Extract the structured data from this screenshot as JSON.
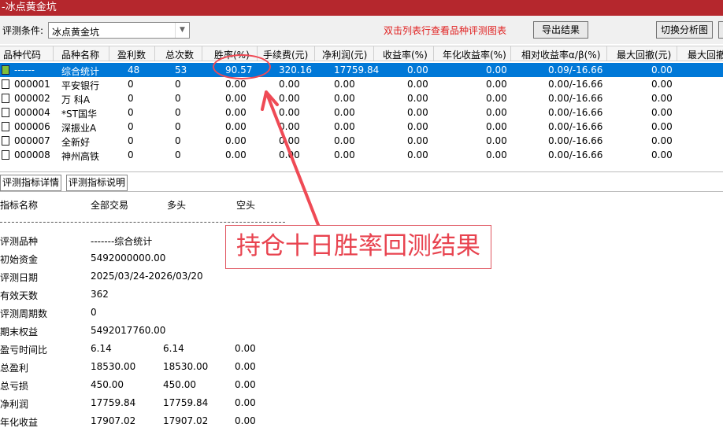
{
  "window": {
    "title": "-冰点黄金坑"
  },
  "toolbar": {
    "condition_label": "评测条件:",
    "condition_value": "冰点黄金坑",
    "hint": "双击列表行查看品种评测图表",
    "export_label": "导出结果",
    "switch_label": "切换分析图"
  },
  "table": {
    "headers": [
      "品种代码",
      "品种名称",
      "盈利数",
      "总次数",
      "胜率(%)",
      "手续费(元)",
      "净利润(元)",
      "收益率(%)",
      "年化收益率(%)",
      "相对收益率α/β(%)",
      "最大回撤(元)",
      "最大回撤"
    ],
    "rows": [
      {
        "code": "------",
        "name": "综合统计",
        "profit_count": "48",
        "total": "53",
        "win_rate": "90.57",
        "fee": "320.16",
        "net": "17759.84",
        "ret": "0.00",
        "annual": "0.00",
        "alpha": "0.09/-16.66",
        "drawdown": "0.00"
      },
      {
        "code": "000001",
        "name": "平安银行",
        "profit_count": "0",
        "total": "0",
        "win_rate": "0.00",
        "fee": "0.00",
        "net": "0.00",
        "ret": "0.00",
        "annual": "0.00",
        "alpha": "0.00/-16.66",
        "drawdown": "0.00"
      },
      {
        "code": "000002",
        "name": "万 科A",
        "profit_count": "0",
        "total": "0",
        "win_rate": "0.00",
        "fee": "0.00",
        "net": "0.00",
        "ret": "0.00",
        "annual": "0.00",
        "alpha": "0.00/-16.66",
        "drawdown": "0.00"
      },
      {
        "code": "000004",
        "name": "*ST国华",
        "profit_count": "0",
        "total": "0",
        "win_rate": "0.00",
        "fee": "0.00",
        "net": "0.00",
        "ret": "0.00",
        "annual": "0.00",
        "alpha": "0.00/-16.66",
        "drawdown": "0.00"
      },
      {
        "code": "000006",
        "name": "深振业A",
        "profit_count": "0",
        "total": "0",
        "win_rate": "0.00",
        "fee": "0.00",
        "net": "0.00",
        "ret": "0.00",
        "annual": "0.00",
        "alpha": "0.00/-16.66",
        "drawdown": "0.00"
      },
      {
        "code": "000007",
        "name": "全新好",
        "profit_count": "0",
        "total": "0",
        "win_rate": "0.00",
        "fee": "0.00",
        "net": "0.00",
        "ret": "0.00",
        "annual": "0.00",
        "alpha": "0.00/-16.66",
        "drawdown": "0.00"
      },
      {
        "code": "000008",
        "name": "神州高铁",
        "profit_count": "0",
        "total": "0",
        "win_rate": "0.00",
        "fee": "0.00",
        "net": "0.00",
        "ret": "0.00",
        "annual": "0.00",
        "alpha": "0.00/-16.66",
        "drawdown": "0.00"
      }
    ]
  },
  "tabs": [
    "评测指标详情",
    "评测指标说明"
  ],
  "detail": {
    "headers": {
      "name": "指标名称",
      "all": "全部交易",
      "long": "多头",
      "short": "空头"
    },
    "rows": [
      {
        "name": "评测品种",
        "all": "-------综合统计",
        "long": "",
        "short": ""
      },
      {
        "name": "初始资金",
        "all": "5492000000.00",
        "long": "",
        "short": ""
      },
      {
        "name": "评测日期",
        "all": "2025/03/24-2026/03/20",
        "long": "",
        "short": ""
      },
      {
        "name": "有效天数",
        "all": "362",
        "long": "",
        "short": ""
      },
      {
        "name": "评测周期数",
        "all": "0",
        "long": "",
        "short": ""
      },
      {
        "name": "期末权益",
        "all": "5492017760.00",
        "long": "",
        "short": ""
      },
      {
        "name": "盈亏时间比",
        "all": "6.14",
        "long": "6.14",
        "short": "0.00"
      },
      {
        "name": "总盈利",
        "all": "18530.00",
        "long": "18530.00",
        "short": "0.00"
      },
      {
        "name": "总亏损",
        "all": "450.00",
        "long": "450.00",
        "short": "0.00"
      },
      {
        "name": "净利润",
        "all": "17759.84",
        "long": "17759.84",
        "short": "0.00"
      },
      {
        "name": "年化收益",
        "all": "17907.02",
        "long": "17907.02",
        "short": "0.00"
      }
    ]
  },
  "annotation": {
    "text": "持仓十日胜率回测结果",
    "color": "#e8434f"
  }
}
